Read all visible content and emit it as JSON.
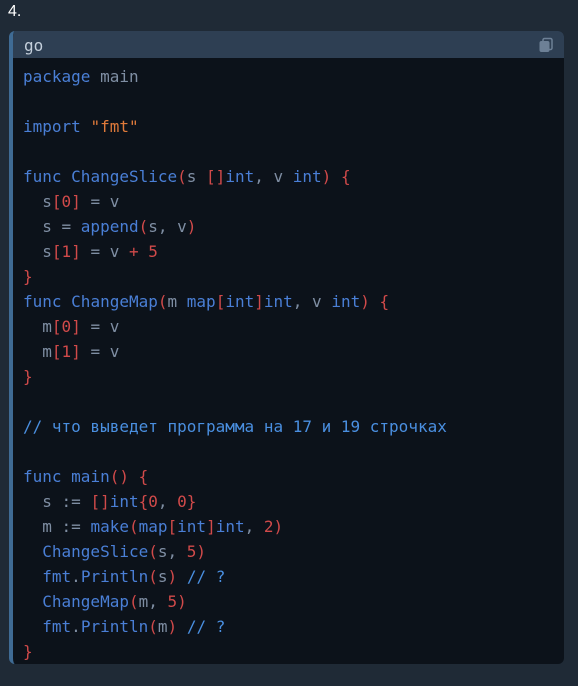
{
  "list_number": "4.",
  "code_block": {
    "language": "go",
    "copy_icon": "copy-icon",
    "lines": [
      [
        {
          "t": "kw",
          "v": "package"
        },
        {
          "t": "id",
          "v": " main"
        }
      ],
      [],
      [
        {
          "t": "kw",
          "v": "import"
        },
        {
          "t": "id",
          "v": " "
        },
        {
          "t": "str",
          "v": "\"fmt\""
        }
      ],
      [],
      [
        {
          "t": "kw",
          "v": "func"
        },
        {
          "t": "id",
          "v": " "
        },
        {
          "t": "fn",
          "v": "ChangeSlice"
        },
        {
          "t": "punc",
          "v": "("
        },
        {
          "t": "id",
          "v": "s "
        },
        {
          "t": "punc",
          "v": "[]"
        },
        {
          "t": "type",
          "v": "int"
        },
        {
          "t": "id",
          "v": ", v "
        },
        {
          "t": "type",
          "v": "int"
        },
        {
          "t": "punc",
          "v": ")"
        },
        {
          "t": "id",
          "v": " "
        },
        {
          "t": "punc",
          "v": "{"
        }
      ],
      [
        {
          "t": "id",
          "v": "  s"
        },
        {
          "t": "punc",
          "v": "["
        },
        {
          "t": "num",
          "v": "0"
        },
        {
          "t": "punc",
          "v": "]"
        },
        {
          "t": "op",
          "v": " = v"
        }
      ],
      [
        {
          "t": "id",
          "v": "  s "
        },
        {
          "t": "op",
          "v": "= "
        },
        {
          "t": "fn",
          "v": "append"
        },
        {
          "t": "punc",
          "v": "("
        },
        {
          "t": "id",
          "v": "s, v"
        },
        {
          "t": "punc",
          "v": ")"
        }
      ],
      [
        {
          "t": "id",
          "v": "  s"
        },
        {
          "t": "punc",
          "v": "["
        },
        {
          "t": "num",
          "v": "1"
        },
        {
          "t": "punc",
          "v": "]"
        },
        {
          "t": "op",
          "v": " = v "
        },
        {
          "t": "punc",
          "v": "+"
        },
        {
          "t": "id",
          "v": " "
        },
        {
          "t": "num",
          "v": "5"
        }
      ],
      [
        {
          "t": "punc",
          "v": "}"
        }
      ],
      [
        {
          "t": "kw",
          "v": "func"
        },
        {
          "t": "id",
          "v": " "
        },
        {
          "t": "fn",
          "v": "ChangeMap"
        },
        {
          "t": "punc",
          "v": "("
        },
        {
          "t": "id",
          "v": "m "
        },
        {
          "t": "type",
          "v": "map"
        },
        {
          "t": "punc",
          "v": "["
        },
        {
          "t": "type",
          "v": "int"
        },
        {
          "t": "punc",
          "v": "]"
        },
        {
          "t": "type",
          "v": "int"
        },
        {
          "t": "id",
          "v": ", v "
        },
        {
          "t": "type",
          "v": "int"
        },
        {
          "t": "punc",
          "v": ")"
        },
        {
          "t": "id",
          "v": " "
        },
        {
          "t": "punc",
          "v": "{"
        }
      ],
      [
        {
          "t": "id",
          "v": "  m"
        },
        {
          "t": "punc",
          "v": "["
        },
        {
          "t": "num",
          "v": "0"
        },
        {
          "t": "punc",
          "v": "]"
        },
        {
          "t": "op",
          "v": " = v"
        }
      ],
      [
        {
          "t": "id",
          "v": "  m"
        },
        {
          "t": "punc",
          "v": "["
        },
        {
          "t": "num",
          "v": "1"
        },
        {
          "t": "punc",
          "v": "]"
        },
        {
          "t": "op",
          "v": " = v"
        }
      ],
      [
        {
          "t": "punc",
          "v": "}"
        }
      ],
      [],
      [
        {
          "t": "com",
          "v": "// что выведет программа на 17 и 19 строчках"
        }
      ],
      [],
      [
        {
          "t": "kw",
          "v": "func"
        },
        {
          "t": "id",
          "v": " "
        },
        {
          "t": "fn",
          "v": "main"
        },
        {
          "t": "punc",
          "v": "()"
        },
        {
          "t": "id",
          "v": " "
        },
        {
          "t": "punc",
          "v": "{"
        }
      ],
      [
        {
          "t": "id",
          "v": "  s "
        },
        {
          "t": "op",
          "v": ":= "
        },
        {
          "t": "punc",
          "v": "[]"
        },
        {
          "t": "type",
          "v": "int"
        },
        {
          "t": "punc",
          "v": "{"
        },
        {
          "t": "num",
          "v": "0"
        },
        {
          "t": "id",
          "v": ", "
        },
        {
          "t": "num",
          "v": "0"
        },
        {
          "t": "punc",
          "v": "}"
        }
      ],
      [
        {
          "t": "id",
          "v": "  m "
        },
        {
          "t": "op",
          "v": ":= "
        },
        {
          "t": "fn",
          "v": "make"
        },
        {
          "t": "punc",
          "v": "("
        },
        {
          "t": "type",
          "v": "map"
        },
        {
          "t": "punc",
          "v": "["
        },
        {
          "t": "type",
          "v": "int"
        },
        {
          "t": "punc",
          "v": "]"
        },
        {
          "t": "type",
          "v": "int"
        },
        {
          "t": "id",
          "v": ", "
        },
        {
          "t": "num",
          "v": "2"
        },
        {
          "t": "punc",
          "v": ")"
        }
      ],
      [
        {
          "t": "id",
          "v": "  "
        },
        {
          "t": "fn",
          "v": "ChangeSlice"
        },
        {
          "t": "punc",
          "v": "("
        },
        {
          "t": "id",
          "v": "s, "
        },
        {
          "t": "num",
          "v": "5"
        },
        {
          "t": "punc",
          "v": ")"
        }
      ],
      [
        {
          "t": "id",
          "v": "  "
        },
        {
          "t": "pkg",
          "v": "fmt"
        },
        {
          "t": "op",
          "v": "."
        },
        {
          "t": "fn",
          "v": "Println"
        },
        {
          "t": "punc",
          "v": "("
        },
        {
          "t": "id",
          "v": "s"
        },
        {
          "t": "punc",
          "v": ")"
        },
        {
          "t": "id",
          "v": " "
        },
        {
          "t": "com",
          "v": "// ?"
        }
      ],
      [
        {
          "t": "id",
          "v": "  "
        },
        {
          "t": "fn",
          "v": "ChangeMap"
        },
        {
          "t": "punc",
          "v": "("
        },
        {
          "t": "id",
          "v": "m, "
        },
        {
          "t": "num",
          "v": "5"
        },
        {
          "t": "punc",
          "v": ")"
        }
      ],
      [
        {
          "t": "id",
          "v": "  "
        },
        {
          "t": "pkg",
          "v": "fmt"
        },
        {
          "t": "op",
          "v": "."
        },
        {
          "t": "fn",
          "v": "Println"
        },
        {
          "t": "punc",
          "v": "("
        },
        {
          "t": "id",
          "v": "m"
        },
        {
          "t": "punc",
          "v": ")"
        },
        {
          "t": "id",
          "v": " "
        },
        {
          "t": "com",
          "v": "// ?"
        }
      ],
      [
        {
          "t": "punc",
          "v": "}"
        }
      ]
    ]
  }
}
